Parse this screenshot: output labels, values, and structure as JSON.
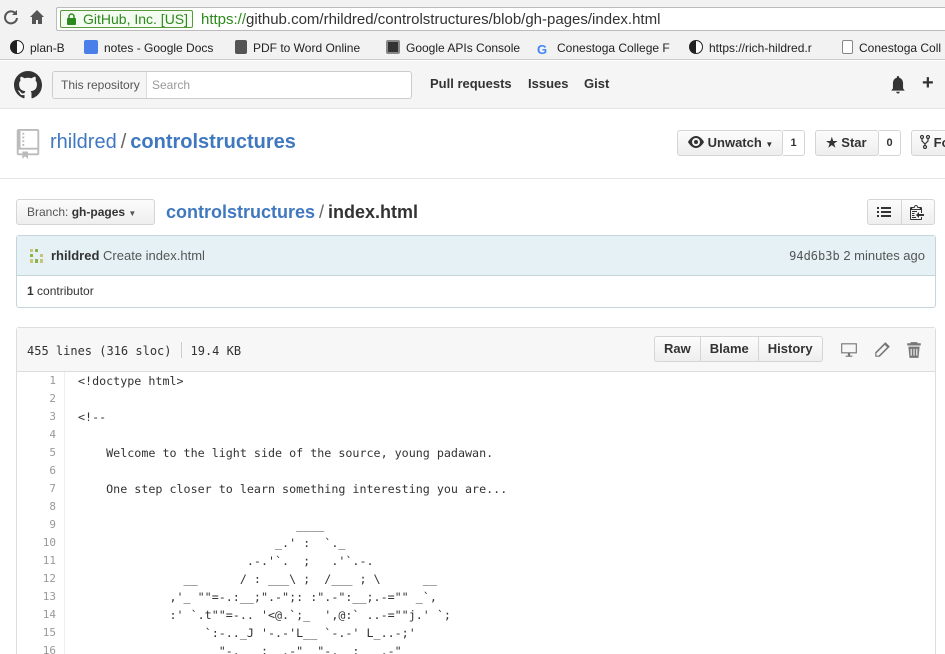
{
  "browser": {
    "ev_label": "GitHub, Inc. [US]",
    "url_scheme": "https://",
    "url_rest": "github.com/rhildred/controlstructures/blob/gh-pages/index.html",
    "bookmarks": [
      {
        "label": "plan-B",
        "icon": "yin-yang-icon"
      },
      {
        "label": "notes - Google Docs",
        "icon": "google-docs-icon"
      },
      {
        "label": "PDF to Word Online",
        "icon": "pdf-icon"
      },
      {
        "label": "Google APIs Console",
        "icon": "console-icon"
      },
      {
        "label": "Conestoga College F",
        "icon": "google-icon"
      },
      {
        "label": "https://rich-hildred.r",
        "icon": "yin-yang-icon"
      },
      {
        "label": "Conestoga Coll",
        "icon": "page-icon"
      }
    ]
  },
  "header": {
    "search_scope": "This repository",
    "search_placeholder": "Search",
    "nav": [
      "Pull requests",
      "Issues",
      "Gist"
    ]
  },
  "repo": {
    "owner": "rhildred",
    "separator": "/",
    "name": "controlstructures",
    "unwatch_label": "Unwatch",
    "unwatch_count": "1",
    "star_label": "Star",
    "star_count": "0",
    "fork_label": "Fo"
  },
  "file_nav": {
    "branch_prefix": "Branch:",
    "branch_name": "gh-pages",
    "crumb_repo": "controlstructures",
    "crumb_sep": "/",
    "crumb_file": "index.html"
  },
  "commit": {
    "author": "rhildred",
    "message": "Create index.html",
    "sha": "94d6b3b",
    "time": "2 minutes ago",
    "contributors_count": "1",
    "contributors_label": "contributor"
  },
  "file": {
    "lines_info": "455 lines (316 sloc)",
    "size": "19.4 KB",
    "buttons": [
      "Raw",
      "Blame",
      "History"
    ],
    "code_lines": [
      {
        "n": "1",
        "text": "<!doctype html>"
      },
      {
        "n": "2",
        "text": ""
      },
      {
        "n": "3",
        "text": "<!--"
      },
      {
        "n": "4",
        "text": ""
      },
      {
        "n": "5",
        "text": "    Welcome to the light side of the source, young padawan."
      },
      {
        "n": "6",
        "text": ""
      },
      {
        "n": "7",
        "text": "    One step closer to learn something interesting you are..."
      },
      {
        "n": "8",
        "text": ""
      },
      {
        "n": "9",
        "text": "                               ____"
      },
      {
        "n": "10",
        "text": "                            _.' :  `._"
      },
      {
        "n": "11",
        "text": "                        .-.'`.  ;   .'`.-."
      },
      {
        "n": "12",
        "text": "               __      / : ___\\ ;  /___ ; \\      __"
      },
      {
        "n": "13",
        "text": "             ,'_ \"\"=-.:__;\".-\";: :\".-\":__;.-=\"\" _`,"
      },
      {
        "n": "14",
        "text": "             :' `.t\"\"=-.. '<@.`;_  ',@:` ..-=\"\"j.' `;"
      },
      {
        "n": "15",
        "text": "                  `:-.._J '-.-'L__ `-.-' L_..-;'"
      },
      {
        "n": "16",
        "text": "                    \"-.__ ;  .-\"  \"-.  : __.-\""
      }
    ]
  }
}
